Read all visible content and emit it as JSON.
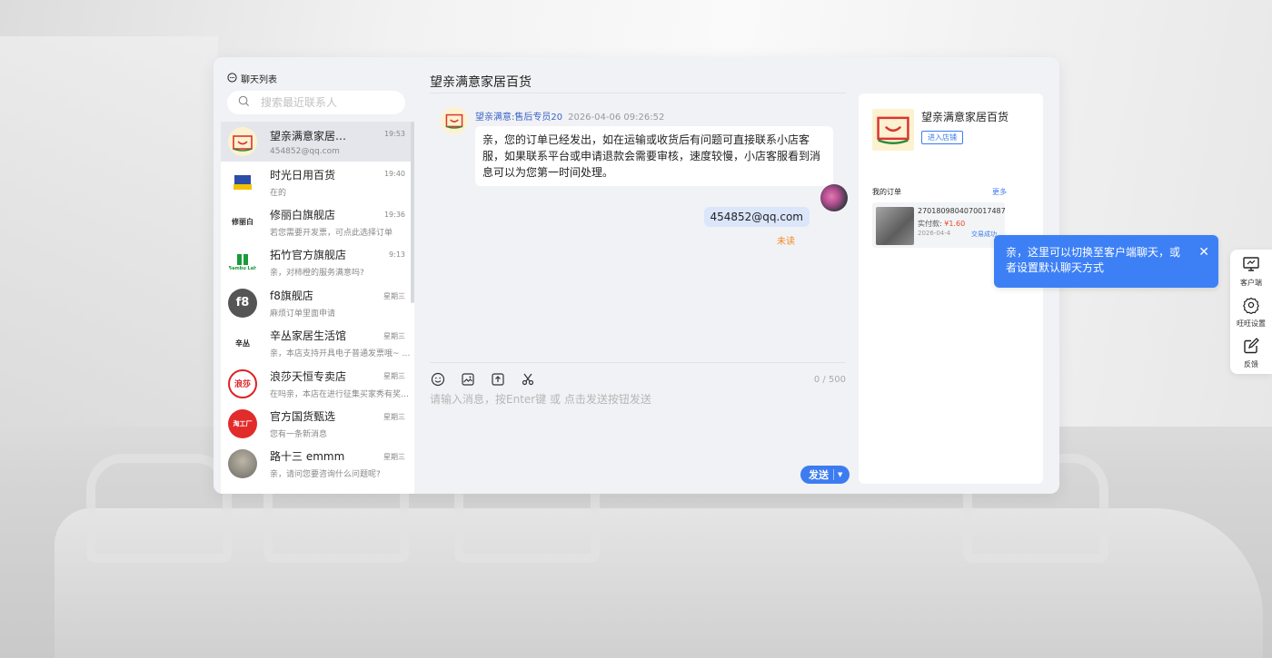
{
  "chat_list": {
    "title": "聊天列表",
    "search_placeholder": "搜索最近联系人",
    "contacts": [
      {
        "name": "望亲满意家居…",
        "msg": "454852@qq.com",
        "time": "19:53",
        "avatar": "shop-logo-smile"
      },
      {
        "name": "时光日用百货",
        "msg": "在的",
        "time": "19:40",
        "avatar": "shop-logo-blue"
      },
      {
        "name": "修丽白旗舰店",
        "msg": "若您需要开发票，可点此选择订单",
        "time": "19:36",
        "avatar_text": "修丽白"
      },
      {
        "name": "拓竹官方旗舰店",
        "msg": "亲，对柿橙的服务满意吗?",
        "time": "9:13",
        "avatar_text": "Bambu Lab"
      },
      {
        "name": "f8旗舰店",
        "msg": "麻烦订单里面申请",
        "time": "星期三",
        "avatar_text": "f8"
      },
      {
        "name": "辛丛家居生活馆",
        "msg": "亲，本店支持开具电子普通发票哦~ …",
        "time": "星期三",
        "avatar_text": "辛丛"
      },
      {
        "name": "浪莎天恒专卖店",
        "msg": "在吗亲，本店在进行征集买家秀有奖…",
        "time": "星期三",
        "avatar_text": "浪莎"
      },
      {
        "name": "官方国货甄选",
        "msg": "您有一条新消息",
        "time": "星期三",
        "avatar_text": "淘工厂"
      },
      {
        "name": "路十三 emmm",
        "msg": "亲，请问您要咨询什么问题呢?",
        "time": "星期三",
        "avatar": "photo"
      }
    ]
  },
  "chat": {
    "title": "望亲满意家居百货",
    "incoming": {
      "sender": "望亲满意:售后专员20",
      "date": "2026-04-06 09:26:52",
      "text": "亲，您的订单已经发出，如在运输或收货后有问题可直接联系小店客服，如果联系平台或申请退款会需要审核，速度较慢，小店客服看到消息可以为您第一时间处理。"
    },
    "outgoing": {
      "text": "454852@qq.com",
      "status": "未读"
    },
    "counter": "0 / 500",
    "input_placeholder": "请输入消息，按Enter键 或 点击发送按钮发送",
    "send_label": "发送",
    "tools": [
      "emoji-icon",
      "image-icon",
      "upload-icon",
      "scissors-icon"
    ]
  },
  "shop_panel": {
    "name": "望亲满意家居百货",
    "enter_label": "进入店铺",
    "orders_title": "我的订单",
    "more_label": "更多",
    "order": {
      "id": "2701809804070017487",
      "paid_label": "实付款: ",
      "price": "¥1.60",
      "date": "2026-04-4",
      "status": "交易成功"
    }
  },
  "tooltip": {
    "text": "亲，这里可以切换至客户端聊天，或者设置默认聊天方式"
  },
  "side_bar": {
    "items": [
      {
        "label": "客户端",
        "icon": "monitor-icon"
      },
      {
        "label": "旺旺设置",
        "icon": "gear-icon"
      },
      {
        "label": "反馈",
        "icon": "edit-icon"
      }
    ]
  },
  "colors": {
    "accent": "#3d7cf0",
    "tooltip_bg": "#3d80f6",
    "unread": "#f08a24",
    "price": "#e84a2a",
    "outgoing_bubble": "#dbe6fb"
  }
}
